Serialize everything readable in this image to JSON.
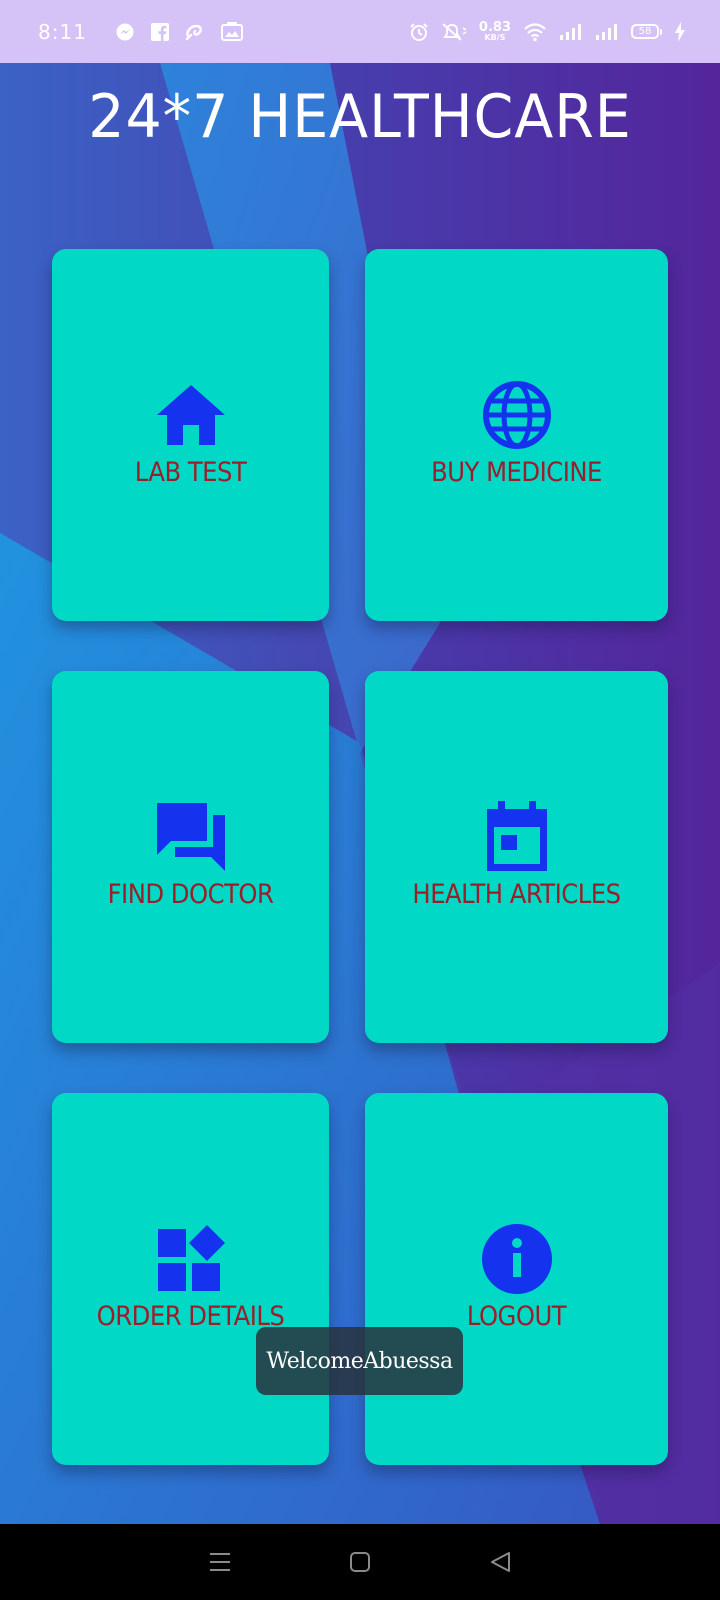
{
  "status_bar": {
    "time": "8:11",
    "net_speed_value": "0.83",
    "net_speed_unit": "KB/S",
    "battery_level": "58",
    "left_icons": [
      "messenger-icon",
      "facebook-icon",
      "airtel-icon",
      "gallery-icon"
    ],
    "right_icons": [
      "alarm-icon",
      "silent-icon",
      "wifi-icon",
      "signal-icon",
      "signal-icon",
      "battery-icon",
      "charging-icon"
    ]
  },
  "app": {
    "title": "24*7 HEALTHCARE"
  },
  "menu": {
    "items": [
      {
        "label": "LAB TEST",
        "icon": "home-icon"
      },
      {
        "label": "BUY MEDICINE",
        "icon": "globe-icon"
      },
      {
        "label": "FIND DOCTOR",
        "icon": "chat-icon"
      },
      {
        "label": "HEALTH ARTICLES",
        "icon": "calendar-icon"
      },
      {
        "label": "ORDER DETAILS",
        "icon": "widgets-icon"
      },
      {
        "label": "LOGOUT",
        "icon": "info-icon"
      }
    ]
  },
  "toast": {
    "message": "WelcomeAbuessa"
  },
  "nav_bar": {
    "buttons": [
      "menu-icon",
      "home-square-icon",
      "back-icon"
    ]
  },
  "colors": {
    "status_bar_bg": "#d5c2f7",
    "card_bg": "#01d9c6",
    "card_label": "#9b1f2a",
    "icon": "#1533ee",
    "title": "#ffffff"
  }
}
